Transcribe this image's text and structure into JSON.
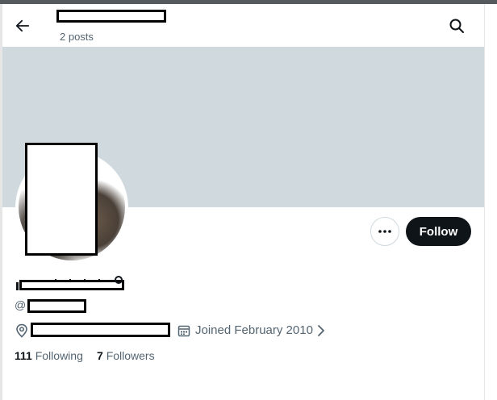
{
  "header": {
    "post_count": "2 posts"
  },
  "profile": {
    "handle_prefix": "@",
    "joined": "Joined February 2010",
    "following_count": "111",
    "following_label": "Following",
    "followers_count": "7",
    "followers_label": "Followers"
  },
  "actions": {
    "follow_label": "Follow"
  },
  "colors": {
    "banner": "#cfd9de",
    "follow_button_bg": "#0f1419",
    "secondary_text": "#536471"
  },
  "icons": [
    "back-arrow-icon",
    "search-icon",
    "more-icon",
    "location-icon",
    "calendar-icon",
    "chevron-right-icon"
  ]
}
